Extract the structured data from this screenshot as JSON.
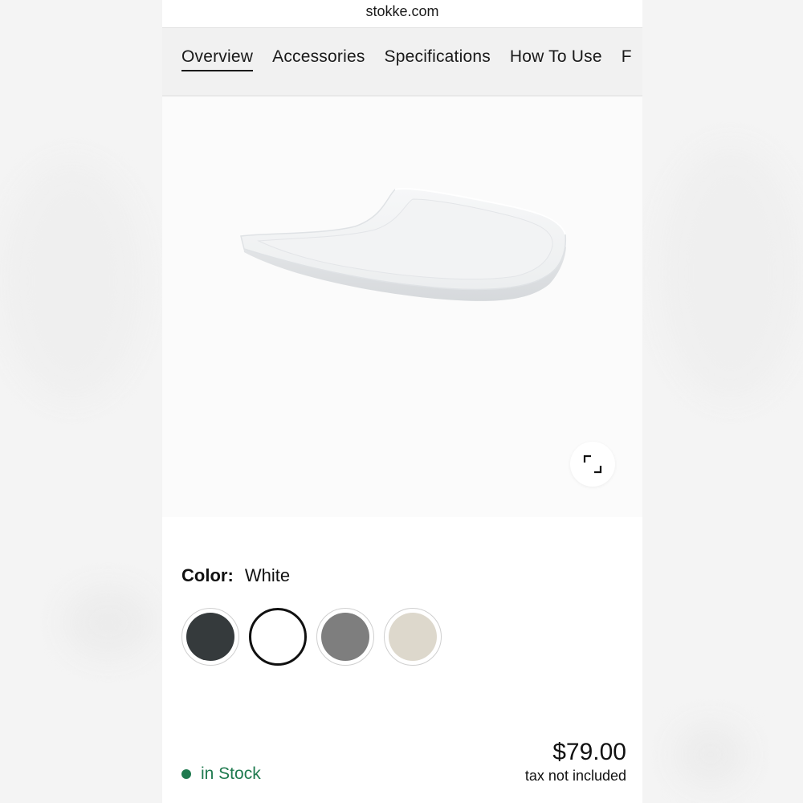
{
  "browser": {
    "url": "stokke.com"
  },
  "nav": {
    "tabs": [
      {
        "label": "Overview",
        "active": true
      },
      {
        "label": "Accessories",
        "active": false
      },
      {
        "label": "Specifications",
        "active": false
      },
      {
        "label": "How To Use",
        "active": false
      },
      {
        "label": "F",
        "active": false
      }
    ]
  },
  "hero": {
    "product_image": "white-tray",
    "expand_icon": "expand-icon"
  },
  "color": {
    "label": "Color:",
    "value": "White",
    "swatches": [
      {
        "name": "Black",
        "hex": "#353a3c",
        "selected": false
      },
      {
        "name": "White",
        "hex": "#ffffff",
        "selected": true
      },
      {
        "name": "Grey",
        "hex": "#7e7e7e",
        "selected": false
      },
      {
        "name": "Beige",
        "hex": "#ddd8cc",
        "selected": false
      }
    ]
  },
  "availability": {
    "text": "in Stock",
    "color": "#1f7a4f"
  },
  "pricing": {
    "price": "$79.00",
    "tax_note": "tax not included"
  }
}
